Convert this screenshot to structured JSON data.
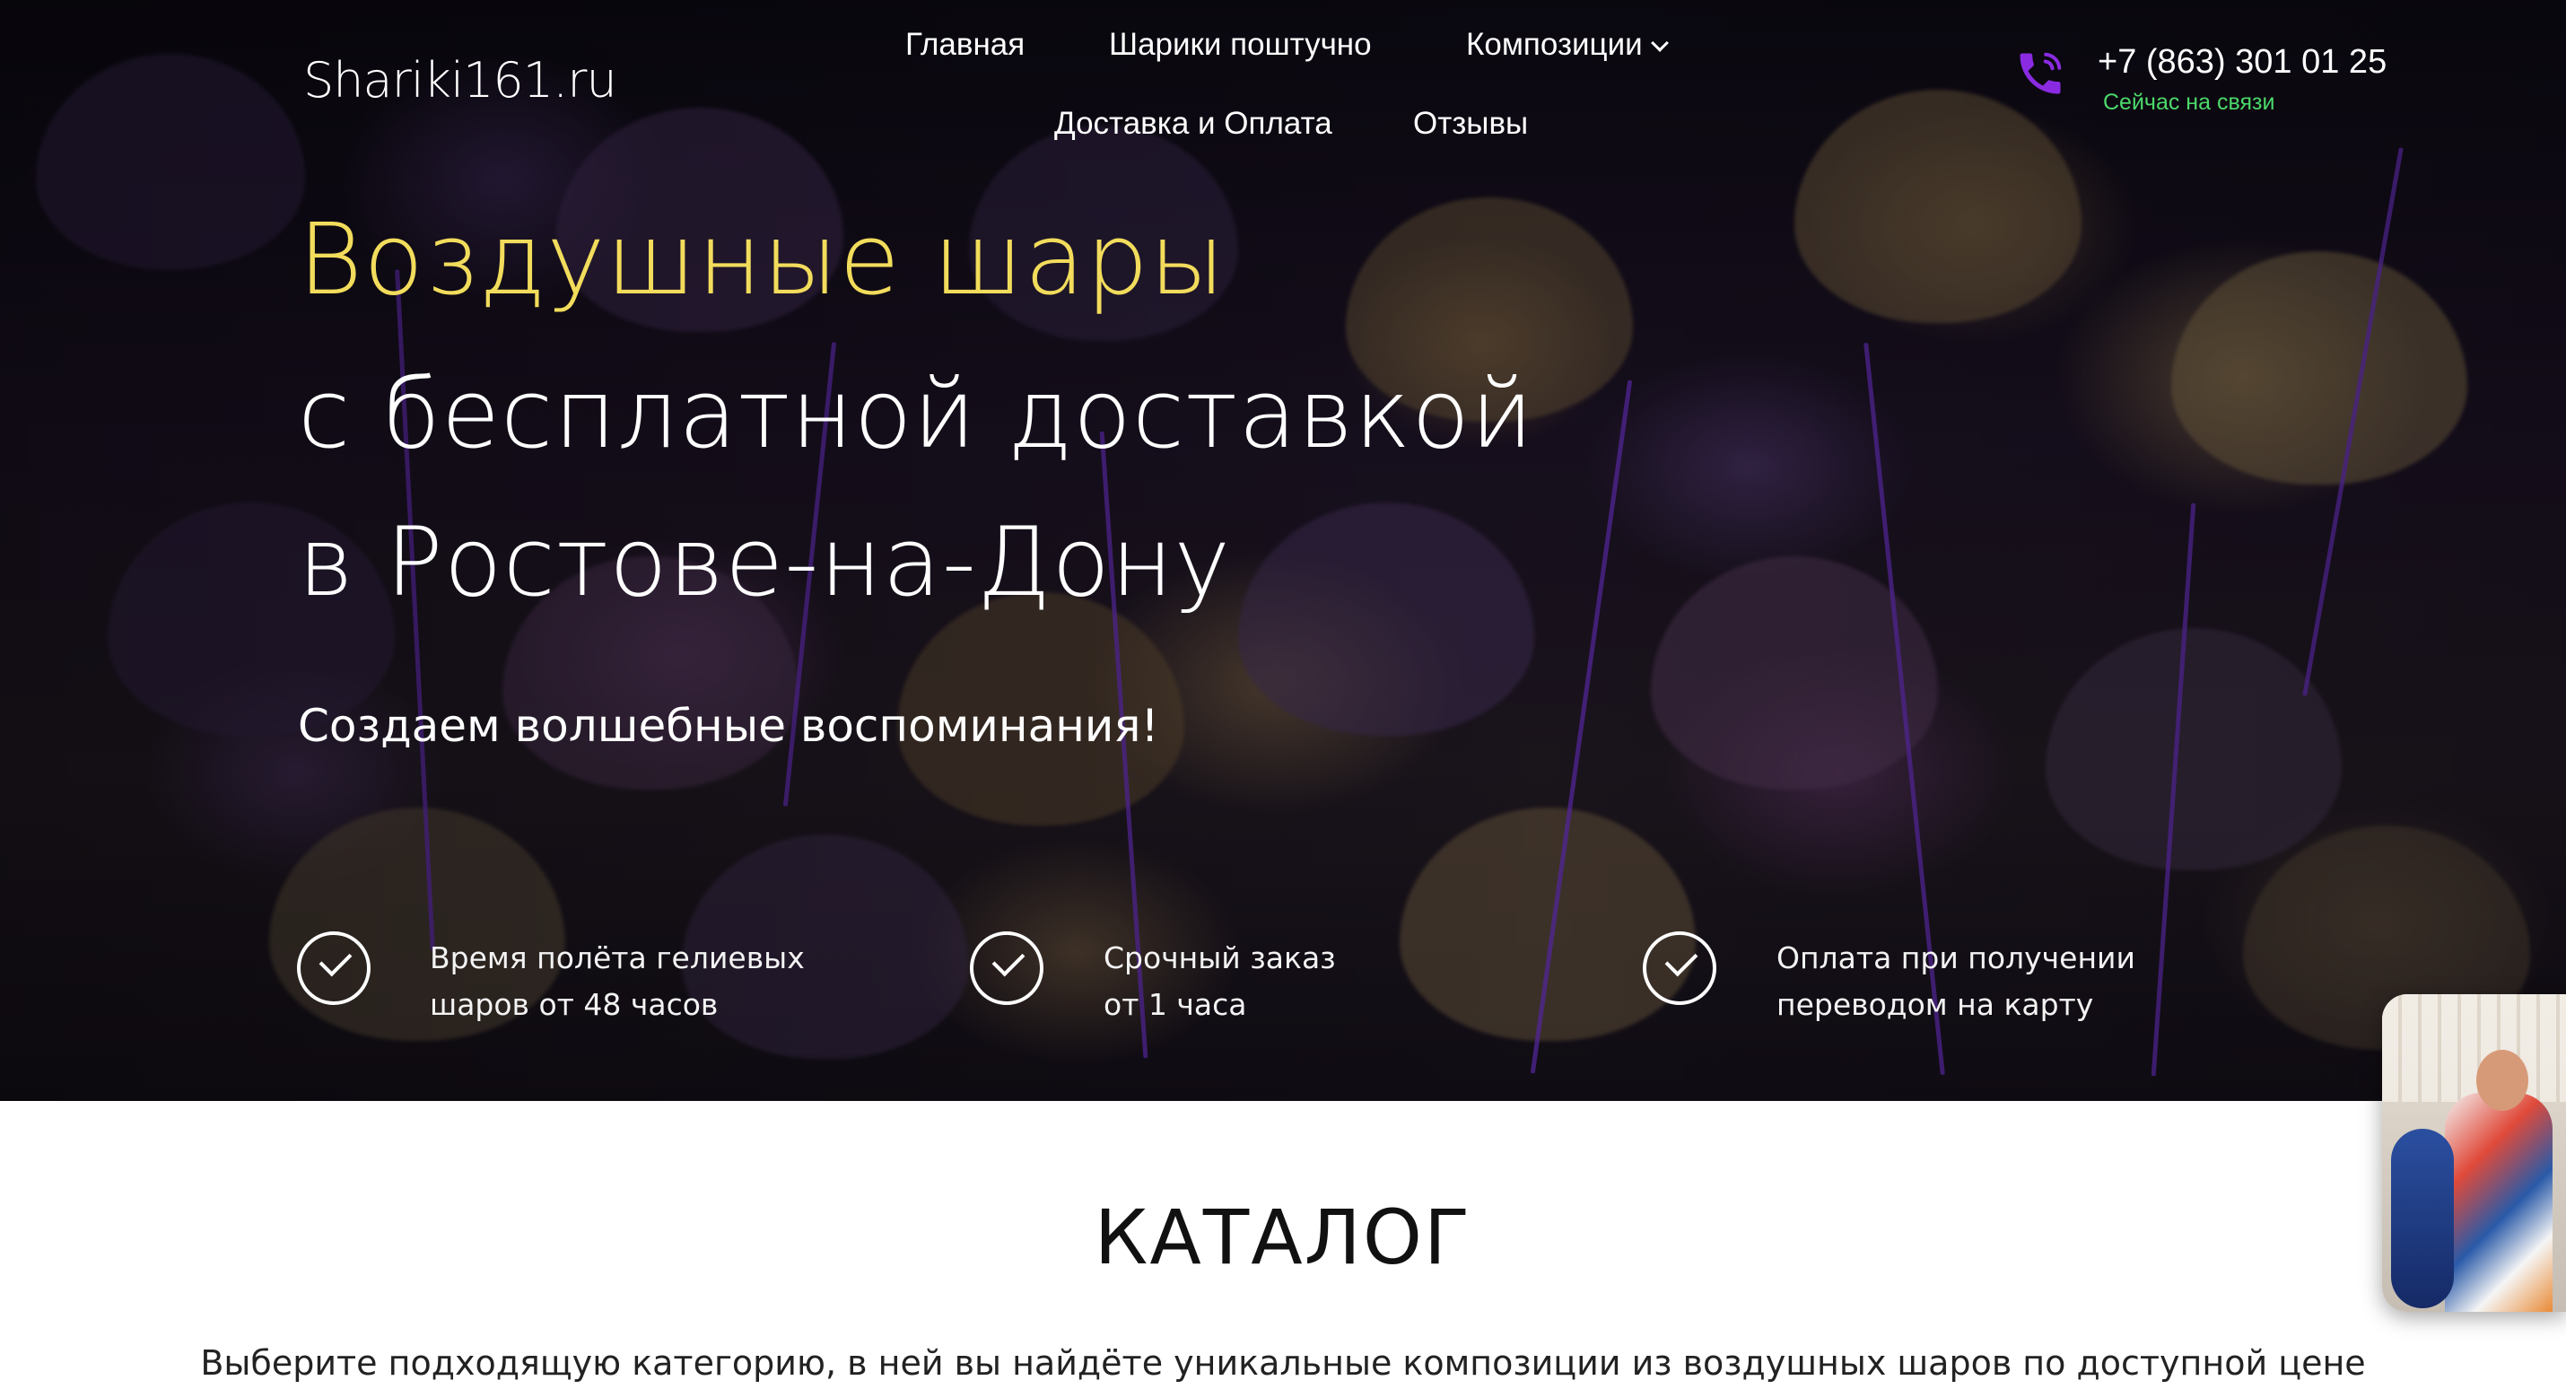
{
  "header": {
    "logo": "Shariki161.ru",
    "nav": [
      {
        "label": "Главная"
      },
      {
        "label": "Шарики поштучно"
      },
      {
        "label": "Композиции",
        "has_dropdown": true
      },
      {
        "label": "Доставка и Оплата"
      },
      {
        "label": "Отзывы"
      }
    ],
    "phone": {
      "icon": "phone-icon",
      "number": "+7 (863) 301 01 25",
      "status": "Сейчас на связи"
    }
  },
  "hero": {
    "title_line1": "Воздушные шары",
    "title_line2": "с бесплатной доставкой",
    "title_line3": "в Ростове-на-Дону",
    "subtitle": "Создаем волшебные воспоминания!",
    "features": [
      {
        "icon": "check-circle-icon",
        "line1": "Время полёта гелиевых",
        "line2": "шаров от 48 часов"
      },
      {
        "icon": "check-circle-icon",
        "line1": "Срочный заказ",
        "line2": "от  1 часа"
      },
      {
        "icon": "check-circle-icon",
        "line1": "Оплата при получении",
        "line2": "переводом на карту"
      }
    ]
  },
  "catalog": {
    "title": "КАТАЛОГ",
    "description": "Выберите подходящую категорию, в ней вы найдёте уникальные композиции из воздушных шаров по доступной цене"
  },
  "colors": {
    "title_accent": "#f2dc5c",
    "phone_icon": "#8a2be2",
    "status_green": "#4cd96a"
  }
}
